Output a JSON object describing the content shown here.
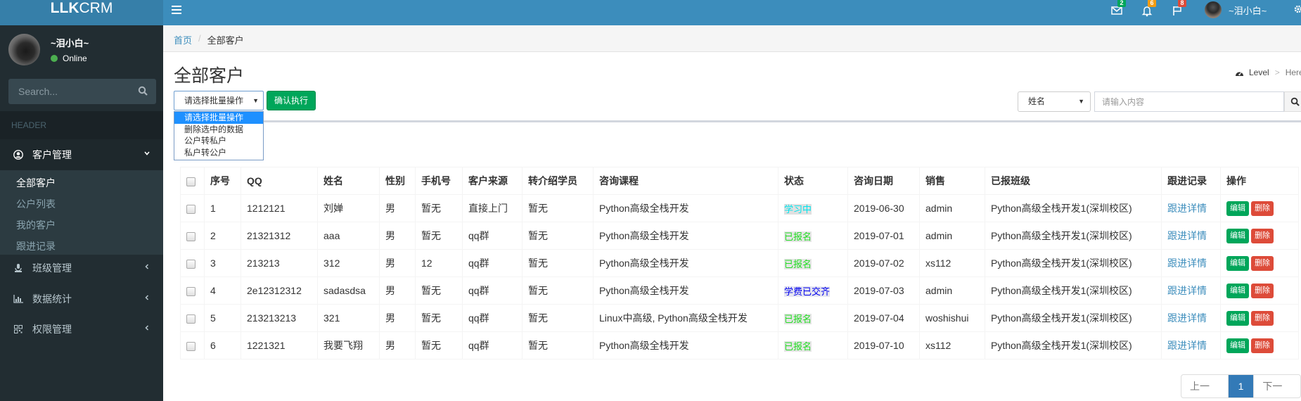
{
  "app": {
    "logo_bold": "LLK",
    "logo_rest": "CRM"
  },
  "header": {
    "notifications": [
      {
        "icon": "envelope-icon",
        "count": "2",
        "color": "#00a65a"
      },
      {
        "icon": "bell-icon",
        "count": "6",
        "color": "#f39c12"
      },
      {
        "icon": "flag-icon",
        "count": "8",
        "color": "#dd4b39"
      }
    ],
    "user_name": "~泪小白~"
  },
  "sidebar": {
    "user_name": "~泪小白~",
    "status": "Online",
    "search_placeholder": "Search...",
    "section_header": "HEADER",
    "menus": [
      {
        "label": "客户管理",
        "icon": "user-circle-icon",
        "expanded": true,
        "children": [
          {
            "label": "全部客户",
            "active": true
          },
          {
            "label": "公户列表",
            "active": false
          },
          {
            "label": "我的客户",
            "active": false
          },
          {
            "label": "跟进记录",
            "active": false
          }
        ]
      },
      {
        "label": "班级管理",
        "icon": "podcast-icon",
        "expanded": false
      },
      {
        "label": "数据统计",
        "icon": "bar-chart-icon",
        "expanded": false
      },
      {
        "label": "权限管理",
        "icon": "qrcode-icon",
        "expanded": false
      }
    ]
  },
  "breadcrumb": {
    "home": "首页",
    "current": "全部客户"
  },
  "page": {
    "title": "全部客户",
    "level_label": "Level",
    "here_label": "Here"
  },
  "toolbar": {
    "bulk_selected": "请选择批量操作",
    "bulk_options": [
      "请选择批量操作",
      "删除选中的数据",
      "公户转私户",
      "私户转公户"
    ],
    "execute_label": "确认执行",
    "field_selected": "姓名",
    "search_placeholder": "请输入内容"
  },
  "table": {
    "headers": [
      "序号",
      "QQ",
      "姓名",
      "性别",
      "手机号",
      "客户来源",
      "转介绍学员",
      "咨询课程",
      "状态",
      "咨询日期",
      "销售",
      "已报班级",
      "跟进记录",
      "操作"
    ],
    "rows": [
      {
        "no": "1",
        "qq": "1212121",
        "name": "刘婵",
        "gender": "男",
        "phone": "暂无",
        "source": "直接上门",
        "referrer": "暂无",
        "course": "Python高级全栈开发",
        "status": "学习中",
        "status_type": "study",
        "date": "2019-06-30",
        "sales": "admin",
        "class": "Python高级全栈开发1(深圳校区)",
        "follow": "跟进详情"
      },
      {
        "no": "2",
        "qq": "21321312",
        "name": "aaa",
        "gender": "男",
        "phone": "暂无",
        "source": "qq群",
        "referrer": "暂无",
        "course": "Python高级全栈开发",
        "status": "已报名",
        "status_type": "enrolled",
        "date": "2019-07-01",
        "sales": "admin",
        "class": "Python高级全栈开发1(深圳校区)",
        "follow": "跟进详情"
      },
      {
        "no": "3",
        "qq": "213213",
        "name": "312",
        "gender": "男",
        "phone": "12",
        "source": "qq群",
        "referrer": "暂无",
        "course": "Python高级全栈开发",
        "status": "已报名",
        "status_type": "enrolled",
        "date": "2019-07-02",
        "sales": "xs112",
        "class": "Python高级全栈开发1(深圳校区)",
        "follow": "跟进详情"
      },
      {
        "no": "4",
        "qq": "2e12312312",
        "name": "sadasdsa",
        "gender": "男",
        "phone": "暂无",
        "source": "qq群",
        "referrer": "暂无",
        "course": "Python高级全栈开发",
        "status": "学费已交齐",
        "status_type": "paid",
        "date": "2019-07-03",
        "sales": "admin",
        "class": "Python高级全栈开发1(深圳校区)",
        "follow": "跟进详情"
      },
      {
        "no": "5",
        "qq": "213213213",
        "name": "321",
        "gender": "男",
        "phone": "暂无",
        "source": "qq群",
        "referrer": "暂无",
        "course": "Linux中高级, Python高级全栈开发",
        "status": "已报名",
        "status_type": "enrolled",
        "date": "2019-07-04",
        "sales": "woshishui",
        "class": "Python高级全栈开发1(深圳校区)",
        "follow": "跟进详情"
      },
      {
        "no": "6",
        "qq": "1221321",
        "name": "我要飞翔",
        "gender": "男",
        "phone": "暂无",
        "source": "qq群",
        "referrer": "暂无",
        "course": "Python高级全栈开发",
        "status": "已报名",
        "status_type": "enrolled",
        "date": "2019-07-10",
        "sales": "xs112",
        "class": "Python高级全栈开发1(深圳校区)",
        "follow": "跟进详情"
      }
    ],
    "edit_label": "编辑",
    "delete_label": "删除"
  },
  "pagination": {
    "prev": "上一页",
    "current": "1",
    "next": "下一页"
  },
  "colors": {
    "header": "#3c8dbc",
    "logo_bg": "#367fa9",
    "sidebar": "#222d32",
    "success": "#00a65a",
    "danger": "#dd4b39",
    "link": "#3c8dbc"
  }
}
